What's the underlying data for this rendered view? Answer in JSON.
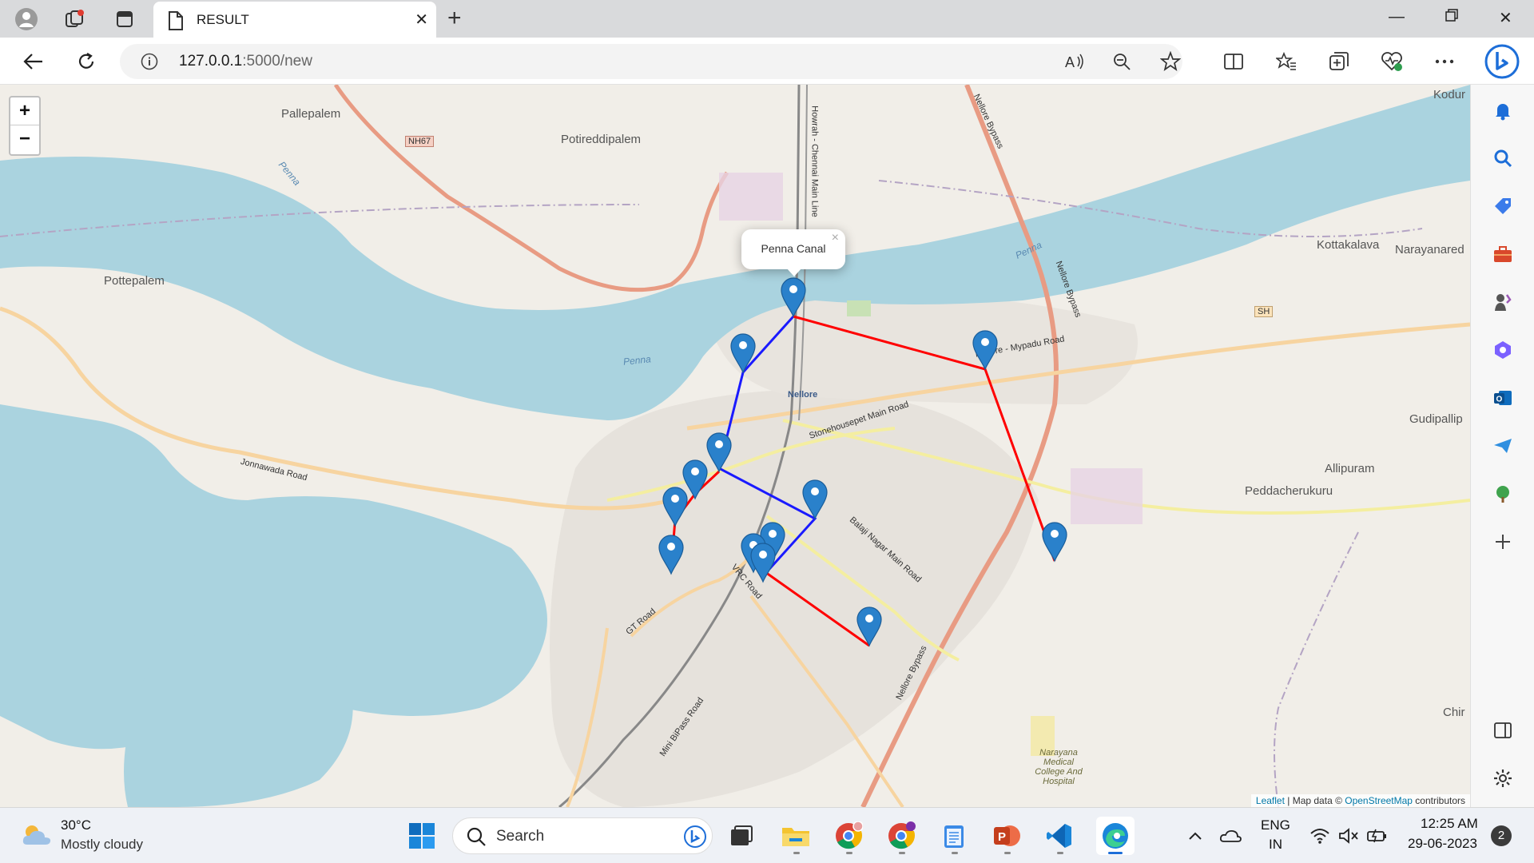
{
  "browser": {
    "tab_title": "RESULT",
    "url_host": "127.0.0.1",
    "url_path": ":5000/new"
  },
  "map": {
    "zoom_in": "+",
    "zoom_out": "−",
    "popup_text": "Penna Canal",
    "popup_close": "×",
    "attribution": {
      "leaflet": "Leaflet",
      "separator": " | Map data © ",
      "osm": "OpenStreetMap",
      "suffix": " contributors"
    },
    "labels": {
      "pallepalem": "Pallepalem",
      "potireddipalem": "Potireddipalem",
      "pottepalem": "Pottepalem",
      "kottakalava": "Kottakalava",
      "narayanared": "Narayanared",
      "gudipallip": "Gudipallip",
      "allipuram": "Allipuram",
      "peddacherukuru": "Peddacherukuru",
      "kodur": "Kodur",
      "chir": "Chir",
      "nellore_city": "Nellore",
      "nh67": "NH67",
      "sh": "SH",
      "penna1": "Penna",
      "penna2": "Penna",
      "penna3": "Penna",
      "jonnawada": "Jonnawada Road",
      "stonehousepet": "Stonehousepet Main Road",
      "mypadu": "Nellore - Mypadu Road",
      "balaji": "Balaji Nagar Main Road",
      "gt_road": "GT Road",
      "vrc_road": "VRC Road",
      "mini_bypass": "Mini BiPass Road",
      "bypass1": "Nellore Bypass",
      "bypass2": "Nellore Bypass",
      "bypass3": "Nellore Bypass",
      "narayana": "Narayana Medical College And Hospital",
      "howrah": "Howrah - Chennai Main Line"
    }
  },
  "taskbar": {
    "temperature": "30°C",
    "weather": "Mostly cloudy",
    "search_label": "Search",
    "lang_top": "ENG",
    "lang_bottom": "IN",
    "time": "12:25 AM",
    "date": "29-06-2023",
    "notification_count": "2"
  }
}
